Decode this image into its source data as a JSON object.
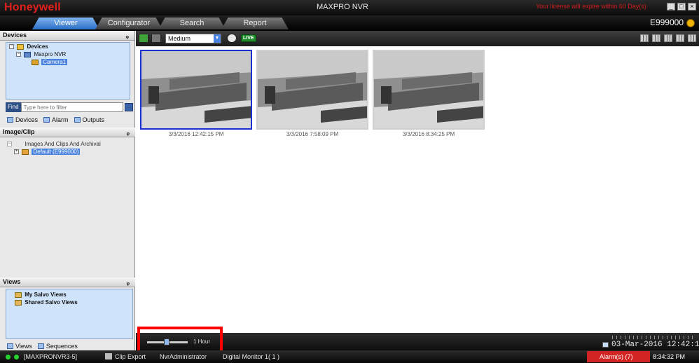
{
  "app": {
    "brand": "Honeywell",
    "title": "MAXPRO NVR",
    "license_notice": "Your license will expire within 60 Day(s)",
    "user_id": "E999000"
  },
  "tabs": [
    {
      "label": "Viewer",
      "active": true
    },
    {
      "label": "Configurator",
      "active": false
    },
    {
      "label": "Search",
      "active": false
    },
    {
      "label": "Report",
      "active": false
    }
  ],
  "devices_panel": {
    "title": "Devices",
    "tree": {
      "root": "Devices",
      "child": "Maxpro NVR",
      "camera": "Camera1"
    },
    "find_label": "Find",
    "find_placeholder": "Type here to filter",
    "subtabs": [
      "Devices",
      "Alarm",
      "Outputs"
    ]
  },
  "image_clip_panel": {
    "title": "Image/Clip",
    "root": "Images And Clips And Archival",
    "child": "Default (E999000)"
  },
  "views_panel": {
    "title": "Views",
    "items": [
      "My Salvo Views",
      "Shared Salvo Views"
    ],
    "subtabs": [
      "Views",
      "Sequences"
    ]
  },
  "toolbar": {
    "quality": "Medium",
    "live_label": "LIVE"
  },
  "thumbnails": [
    {
      "timestamp": "3/3/2016 12:42:15 PM",
      "selected": true
    },
    {
      "timestamp": "3/3/2016 7:58:09 PM",
      "selected": false
    },
    {
      "timestamp": "3/3/2016 8:34:25 PM",
      "selected": false
    }
  ],
  "timeline": {
    "zoom_label": "1 Hour",
    "current_datetime": "03-Mar-2016 12:42:1"
  },
  "status_bar": {
    "server": "[MAXPRONVR3-5]",
    "clip_export": "Clip Export",
    "user": "NvrAdministrator",
    "monitor": "Digital Monitor 1( 1 )",
    "alarm": "Alarm(s) (7)",
    "time": "8:34:32 PM"
  },
  "colors": {
    "brand_red": "#e0201b",
    "selection_blue": "#1d2fd0",
    "alarm_red": "#d32424",
    "highlight_red": "#ff0000"
  }
}
